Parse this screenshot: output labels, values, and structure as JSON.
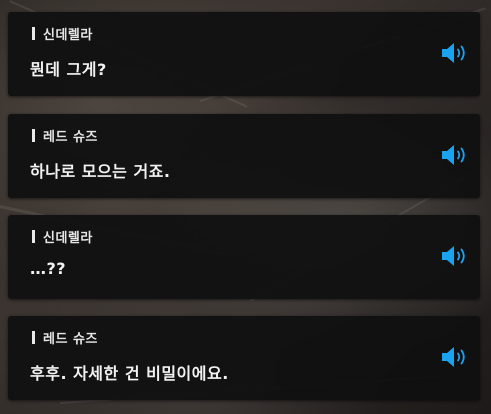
{
  "accent_color": "#1aa3f0",
  "dialogue": [
    {
      "speaker": "신데렐라",
      "text": "뭔데 그게?",
      "voice_icon": "speaker-volume-icon"
    },
    {
      "speaker": "레드 슈즈",
      "text": "하나로 모으는 거죠.",
      "voice_icon": "speaker-volume-icon"
    },
    {
      "speaker": "신데렐라",
      "text": "…??",
      "voice_icon": "speaker-volume-icon"
    },
    {
      "speaker": "레드 슈즈",
      "text": "후후. 자세한 건 비밀이에요.",
      "voice_icon": "speaker-volume-icon"
    }
  ]
}
